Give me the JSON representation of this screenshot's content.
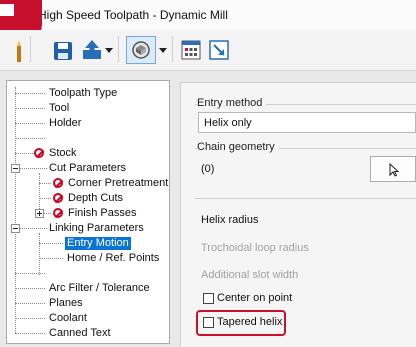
{
  "window": {
    "title": "High Speed Toolpath - Dynamic Mill"
  },
  "colors": {
    "accent": "#c8102e",
    "selection": "#0a74d6",
    "no_symbol": "#d1001f"
  },
  "toolbar": {
    "icons": [
      "pencil-icon",
      "save-icon",
      "upload-icon",
      "dropdown-arrow-icon",
      "view-sphere-icon",
      "dropdown-arrow-icon",
      "calculator-icon",
      "resize-arrow-icon"
    ]
  },
  "tree": {
    "items": [
      {
        "label": "Toolpath Type"
      },
      {
        "label": "Tool"
      },
      {
        "label": "Holder"
      },
      {
        "label": "Stock"
      },
      {
        "label": "Cut Parameters"
      },
      {
        "label": "Corner Pretreatment"
      },
      {
        "label": "Depth Cuts"
      },
      {
        "label": "Finish Passes"
      },
      {
        "label": "Linking Parameters"
      },
      {
        "label": "Entry Motion"
      },
      {
        "label": "Home / Ref. Points"
      },
      {
        "label": "Arc Filter / Tolerance"
      },
      {
        "label": "Planes"
      },
      {
        "label": "Coolant"
      },
      {
        "label": "Canned Text"
      }
    ]
  },
  "entry_method": {
    "label": "Entry method",
    "value": "Helix only"
  },
  "chain_geometry": {
    "label": "Chain geometry",
    "count": "(0)"
  },
  "helix": {
    "radius_label": "Helix radius",
    "trochoidal_label": "Trochoidal loop radius",
    "slot_label": "Additional slot width",
    "center_on_point": "Center on point",
    "tapered_helix": "Tapered helix"
  }
}
